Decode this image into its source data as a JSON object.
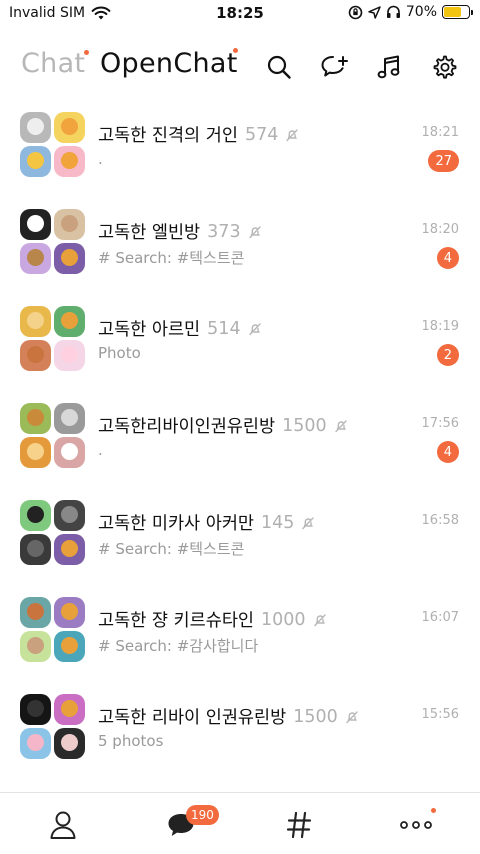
{
  "status": {
    "carrier": "Invalid SIM",
    "time": "18:25",
    "battery": "70%",
    "battery_level": 0.7
  },
  "header": {
    "tab_chat": "Chat",
    "tab_openchat": "OpenChat",
    "accent": "#f26a3d"
  },
  "rooms": [
    {
      "title": "고독한 진격의 거인",
      "count": "574",
      "preview": ".",
      "time": "18:21",
      "unread": "27"
    },
    {
      "title": "고독한 엘빈방",
      "count": "373",
      "preview": "# Search: #텍스트콘",
      "time": "18:20",
      "unread": "4"
    },
    {
      "title": "고독한 아르민",
      "count": "514",
      "preview": "Photo",
      "time": "18:19",
      "unread": "2"
    },
    {
      "title": "고독한리바이인권유린방",
      "count": "1500",
      "preview": ".",
      "time": "17:56",
      "unread": "4"
    },
    {
      "title": "고독한 미카사 아커만",
      "count": "145",
      "preview": "# Search: #텍스트콘",
      "time": "16:58",
      "unread": ""
    },
    {
      "title": "고독한 쟝 키르슈타인",
      "count": "1000",
      "preview": "# Search: #감사합니다",
      "time": "16:07",
      "unread": ""
    },
    {
      "title": "고독한 리바이 인권유린방",
      "count": "1500",
      "preview": "5 photos",
      "time": "15:56",
      "unread": ""
    }
  ],
  "nav": {
    "chat_badge": "190"
  }
}
